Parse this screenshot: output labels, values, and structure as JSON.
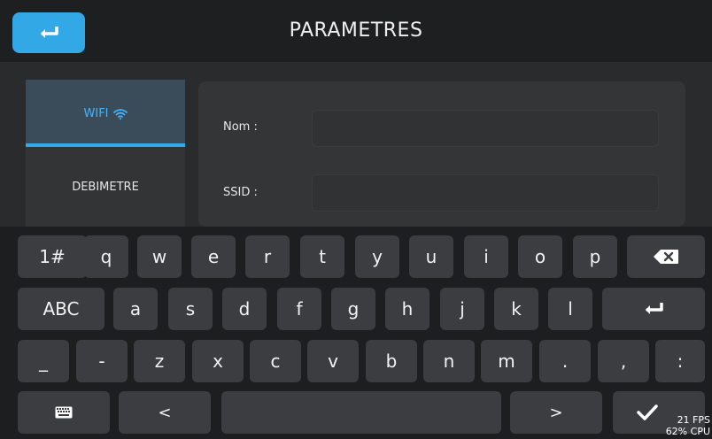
{
  "header": {
    "title": "PARAMETRES"
  },
  "tabs": [
    {
      "label": "WIFI",
      "active": true
    },
    {
      "label": "DEBIMETRE",
      "active": false
    }
  ],
  "form": {
    "fields": [
      {
        "label": "Nom :",
        "value": ""
      },
      {
        "label": "SSID :",
        "value": ""
      }
    ]
  },
  "keyboard": {
    "row1": [
      "1#",
      "q",
      "w",
      "e",
      "r",
      "t",
      "y",
      "u",
      "i",
      "o",
      "p"
    ],
    "row2": [
      "ABC",
      "a",
      "s",
      "d",
      "f",
      "g",
      "h",
      "j",
      "k",
      "l"
    ],
    "row3": [
      "_",
      "-",
      "z",
      "x",
      "c",
      "v",
      "b",
      "n",
      "m",
      ".",
      ",",
      ":"
    ],
    "row4": [
      "<",
      ">"
    ]
  },
  "stats": {
    "fps": "21 FPS",
    "cpu": "62% CPU"
  },
  "colors": {
    "accent": "#33a8e6",
    "active_tab_text": "#43b6ff"
  }
}
